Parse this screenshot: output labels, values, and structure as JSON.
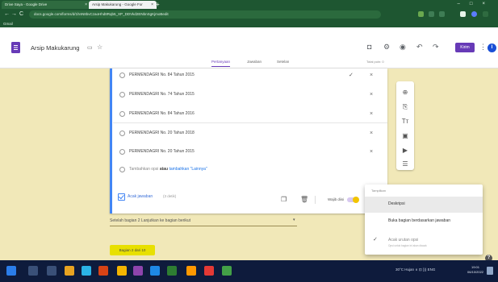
{
  "browser": {
    "tabs": [
      {
        "label": "Drive Saya - Google Drive"
      },
      {
        "label": "Arsip Makukarung - Google For"
      }
    ],
    "url": "docs.google.com/forms/d/1hnN8bvCzaoHhd8Rqb5_XP_DDVkd2ENbnSgKjmoBedit",
    "bookmark": "Gmail"
  },
  "form": {
    "title": "Arsip Makukarung",
    "send_label": "Kirim",
    "avatar_letter": "I",
    "tabs": [
      "Pertanyaan",
      "Jawaban",
      "Setelan"
    ],
    "saved_status": "Total poin: 0"
  },
  "options": [
    {
      "label": "PERMENDAGRI No. 84 Tahun 2015"
    },
    {
      "label": "PERMENDAGRI No. 74 Tahun 2015"
    },
    {
      "label": "PERMENDAGRI No. 84 Tahun 2016"
    },
    {
      "label": "PERMENDAGRI No. 20 Tahun 2018"
    },
    {
      "label": "PERMENDAGRI No. 20 Tahun 2015"
    }
  ],
  "add_option": {
    "add": "Tambahkan opsi",
    "or": "atau",
    "other": "tambahkan \"Lainnya\""
  },
  "shuffle": {
    "label": "Acak jawaban",
    "meta": "(3 detik)"
  },
  "required_label": "Wajib diisi",
  "after_section": {
    "label": "Setelah bagian 2   Lanjutkan ke bagian berikut"
  },
  "section_button": "Bagian 2 dari 10",
  "menu": {
    "header": "Tampilkan",
    "items": [
      "Deskripsi",
      "Buka bagian berdasarkan jawaban",
      "Acak urutan opsi"
    ],
    "sub": "Opsi untuk bagian ini akan diacak"
  },
  "taskbar": {
    "tray": "30°C  Hujan  ∧  ⊡  ))) ENG",
    "time": "19:01",
    "date": "06/10/2022"
  }
}
